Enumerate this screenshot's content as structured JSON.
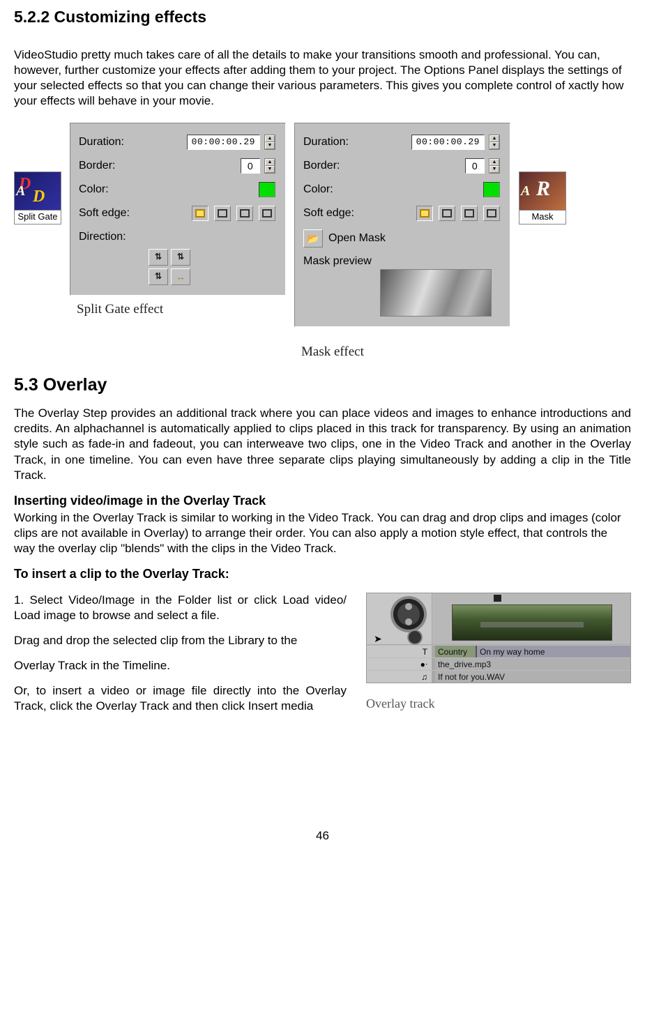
{
  "heading_522": "5.2.2   Customizing effects",
  "para_intro": "VideoStudio pretty much takes care of all the details to make your transitions smooth and professional. You can, however, further customize your effects after adding them to your project. The Options Panel displays the settings of your selected effects so that you can change their various parameters. This gives you complete control of xactly how your effects will behave in your movie.",
  "thumb_split_gate": "Split Gate",
  "thumb_mask": "Mask",
  "panel_splitgate": {
    "duration_label": "Duration:",
    "duration_value": "00:00:00.29",
    "border_label": "Border:",
    "border_value": "0",
    "color_label": "Color:",
    "softedge_label": "Soft edge:",
    "direction_label": "Direction:",
    "caption": "Split Gate effect"
  },
  "panel_mask": {
    "duration_label": "Duration:",
    "duration_value": "00:00:00.29",
    "border_label": "Border:",
    "border_value": "0",
    "color_label": "Color:",
    "softedge_label": "Soft edge:",
    "openmask_label": "Open Mask",
    "maskpreview_label": "Mask preview",
    "caption": "Mask effect"
  },
  "heading_53": "5.3    Overlay",
  "para_53": "The Overlay Step provides an additional track where you can place videos and images to enhance introductions and credits. An alphachannel is automatically applied to clips placed in this track for transparency. By using an animation style such as fade-in and fadeout, you can interweave two clips, one in the Video Track and  another in the Overlay Track, in one timeline. You can even have three separate clips playing simultaneously by adding a clip in the Title Track.",
  "sub_inserting": "Inserting video/image in the Overlay Track",
  "para_inserting": "Working in the Overlay Track is similar to working in the Video Track. You can drag and drop clips and images (color clips are not available in Overlay) to arrange their order. You can also apply a motion style effect, that controls the way the overlay clip \"blends\"  with the clips in the Video Track.",
  "sub_toinsert": "To insert a clip to the Overlay Track:",
  "step1": "1. Select Video/Image in the Folder list or click Load video/ Load image to browse and select a file.",
  "step2": "Drag and drop the selected clip from the Library to the",
  "step3": "Overlay Track in the Timeline.",
  "step4": "Or, to insert a video or image file directly into the Overlay Track, click the Overlay Track and then click Insert media",
  "timeline": {
    "row_t_icon": "T",
    "row_t_a": "Country",
    "row_t_b": "On my way home",
    "row_audio_icon": "●ᐧ",
    "row_audio": "the_drive.mp3",
    "row_music_icon": "♫",
    "row_music": "If not for you.WAV",
    "caption": "Overlay track"
  },
  "page_number": "46"
}
